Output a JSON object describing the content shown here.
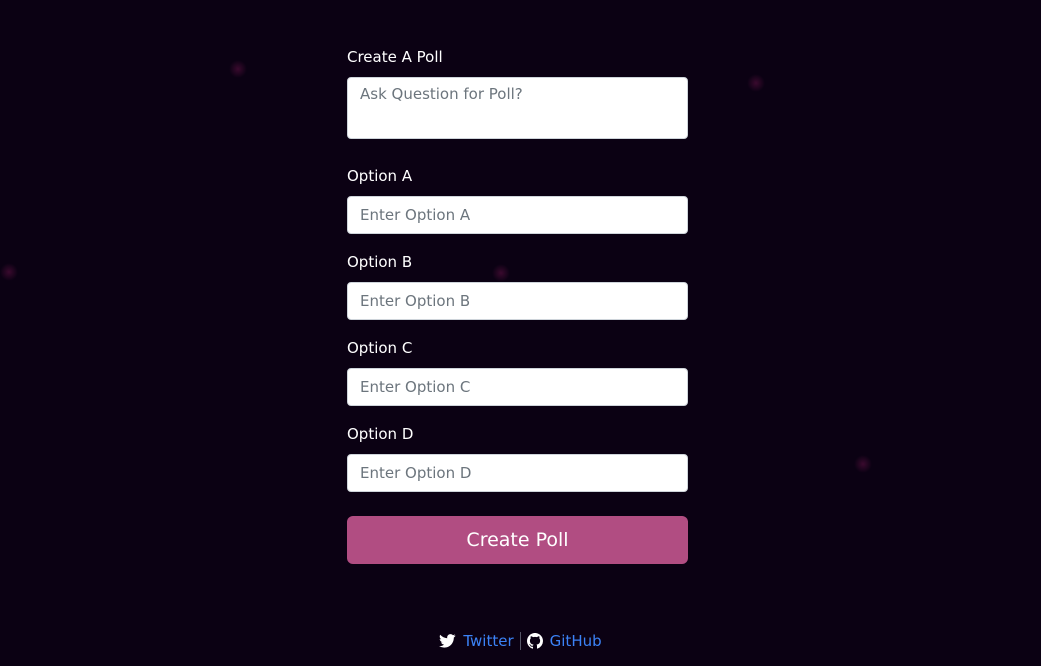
{
  "form": {
    "question_label": "Create A Poll",
    "question_placeholder": "Ask Question for Poll?",
    "options": [
      {
        "label": "Option A",
        "placeholder": "Enter Option A"
      },
      {
        "label": "Option B",
        "placeholder": "Enter Option B"
      },
      {
        "label": "Option C",
        "placeholder": "Enter Option C"
      },
      {
        "label": "Option D",
        "placeholder": "Enter Option D"
      }
    ],
    "submit_label": "Create Poll"
  },
  "footer": {
    "twitter_label": "Twitter",
    "github_label": "GitHub"
  },
  "colors": {
    "background": "#0b0113",
    "button": "#b14d82",
    "link": "#3b82f6"
  }
}
